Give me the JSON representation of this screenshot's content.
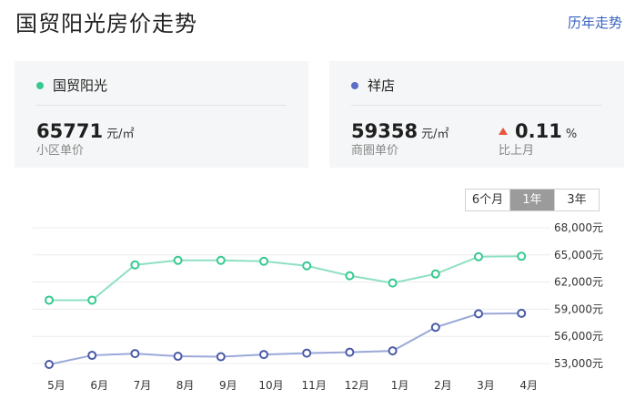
{
  "header": {
    "title": "国贸阳光房价走势",
    "history_link": "历年走势"
  },
  "cards": {
    "community": {
      "name": "国贸阳光",
      "dot_color": "#36c990",
      "price": "65771",
      "unit": "元/㎡",
      "price_label": "小区单价"
    },
    "district": {
      "name": "祥店",
      "dot_color": "#5b6fc7",
      "price": "59358",
      "unit": "元/㎡",
      "price_label": "商圈单价",
      "change_value": "0.11",
      "change_unit": "%",
      "change_label": "比上月",
      "change_direction": "up",
      "change_color": "#e8553d"
    }
  },
  "range_tabs": {
    "options": [
      "6个月",
      "1年",
      "3年"
    ],
    "selected": "1年"
  },
  "chart_data": {
    "type": "line",
    "categories": [
      "5月",
      "6月",
      "7月",
      "8月",
      "9月",
      "10月",
      "11月",
      "12月",
      "1月",
      "2月",
      "3月",
      "4月"
    ],
    "y_ticks": [
      53000,
      56000,
      59000,
      62000,
      65000,
      68000
    ],
    "y_tick_labels": [
      "53,000元",
      "56,000元",
      "59,000元",
      "62,000元",
      "65,000元",
      "68,000元"
    ],
    "ylim": [
      53000,
      68000
    ],
    "grid": true,
    "series": [
      {
        "name": "国贸阳光",
        "color": "#36c990",
        "line_color": "#8fe0c2",
        "values": [
          60000,
          60000,
          63900,
          64400,
          64400,
          64300,
          63800,
          62700,
          61900,
          62900,
          64800,
          64850
        ]
      },
      {
        "name": "祥店",
        "color": "#4a5aa8",
        "line_color": "#9aa8d8",
        "values": [
          52900,
          53900,
          54100,
          53800,
          53750,
          54000,
          54150,
          54250,
          54400,
          57000,
          58500,
          58550
        ]
      }
    ]
  }
}
